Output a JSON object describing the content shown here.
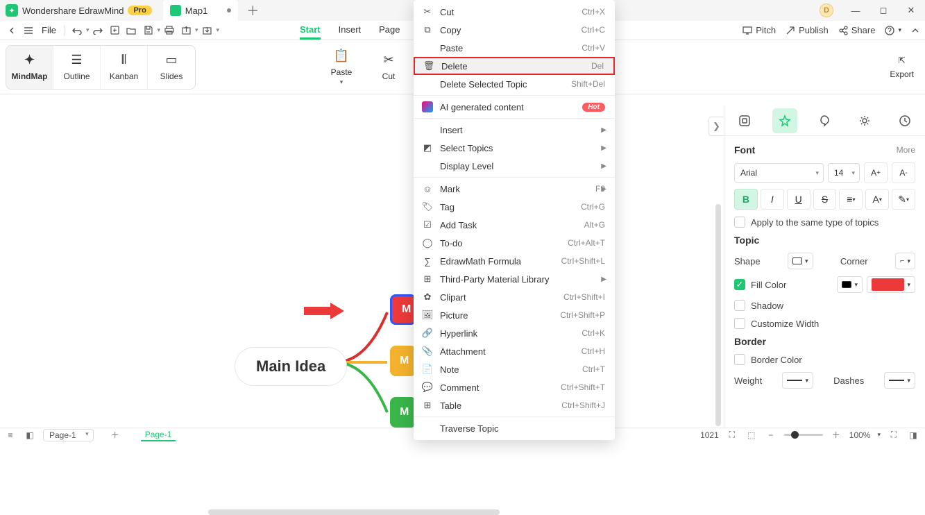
{
  "app": {
    "name": "Wondershare EdrawMind",
    "pro": "Pro"
  },
  "tabs": {
    "doc1": "Map1"
  },
  "avatar": "D",
  "toolbar": {
    "file": "File"
  },
  "ribbon": {
    "tabs": {
      "start": "Start",
      "insert": "Insert",
      "page": "Page"
    },
    "right": {
      "pitch": "Pitch",
      "publish": "Publish",
      "share": "Share"
    },
    "views": {
      "mindmap": "MindMap",
      "outline": "Outline",
      "kanban": "Kanban",
      "slides": "Slides"
    },
    "paste": "Paste",
    "cut": "Cut",
    "export": "Export"
  },
  "canvas": {
    "main": "Main Idea",
    "sub1": "M",
    "sub2": "M",
    "sub3": "M"
  },
  "ctx": {
    "cut": "Cut",
    "cut_s": "Ctrl+X",
    "copy": "Copy",
    "copy_s": "Ctrl+C",
    "paste": "Paste",
    "paste_s": "Ctrl+V",
    "delete": "Delete",
    "delete_s": "Del",
    "delsel": "Delete Selected Topic",
    "delsel_s": "Shift+Del",
    "ai": "AI generated content",
    "hot": "Hot",
    "insert": "Insert",
    "select": "Select Topics",
    "display": "Display Level",
    "mark": "Mark",
    "mark_s": "F9",
    "tag": "Tag",
    "tag_s": "Ctrl+G",
    "addtask": "Add Task",
    "addtask_s": "Alt+G",
    "todo": "To-do",
    "todo_s": "Ctrl+Alt+T",
    "formula": "EdrawMath Formula",
    "formula_s": "Ctrl+Shift+L",
    "thirdparty": "Third-Party Material Library",
    "clipart": "Clipart",
    "clipart_s": "Ctrl+Shift+I",
    "picture": "Picture",
    "picture_s": "Ctrl+Shift+P",
    "hyperlink": "Hyperlink",
    "hyperlink_s": "Ctrl+K",
    "attachment": "Attachment",
    "attachment_s": "Ctrl+H",
    "note": "Note",
    "note_s": "Ctrl+T",
    "comment": "Comment",
    "comment_s": "Ctrl+Shift+T",
    "table": "Table",
    "table_s": "Ctrl+Shift+J",
    "traverse": "Traverse Topic"
  },
  "panel": {
    "font": "Font",
    "more": "More",
    "fontname": "Arial",
    "fontsize": "14",
    "apply_same": "Apply to the same type of topics",
    "topic": "Topic",
    "shape": "Shape",
    "corner": "Corner",
    "fillcolor": "Fill Color",
    "shadow": "Shadow",
    "customwidth": "Customize Width",
    "border": "Border",
    "bordercolor": "Border Color",
    "weight": "Weight",
    "dashes": "Dashes"
  },
  "status": {
    "page_sel": "Page-1",
    "page_tab": "Page-1",
    "coord": "1021",
    "zoom": "100%"
  }
}
